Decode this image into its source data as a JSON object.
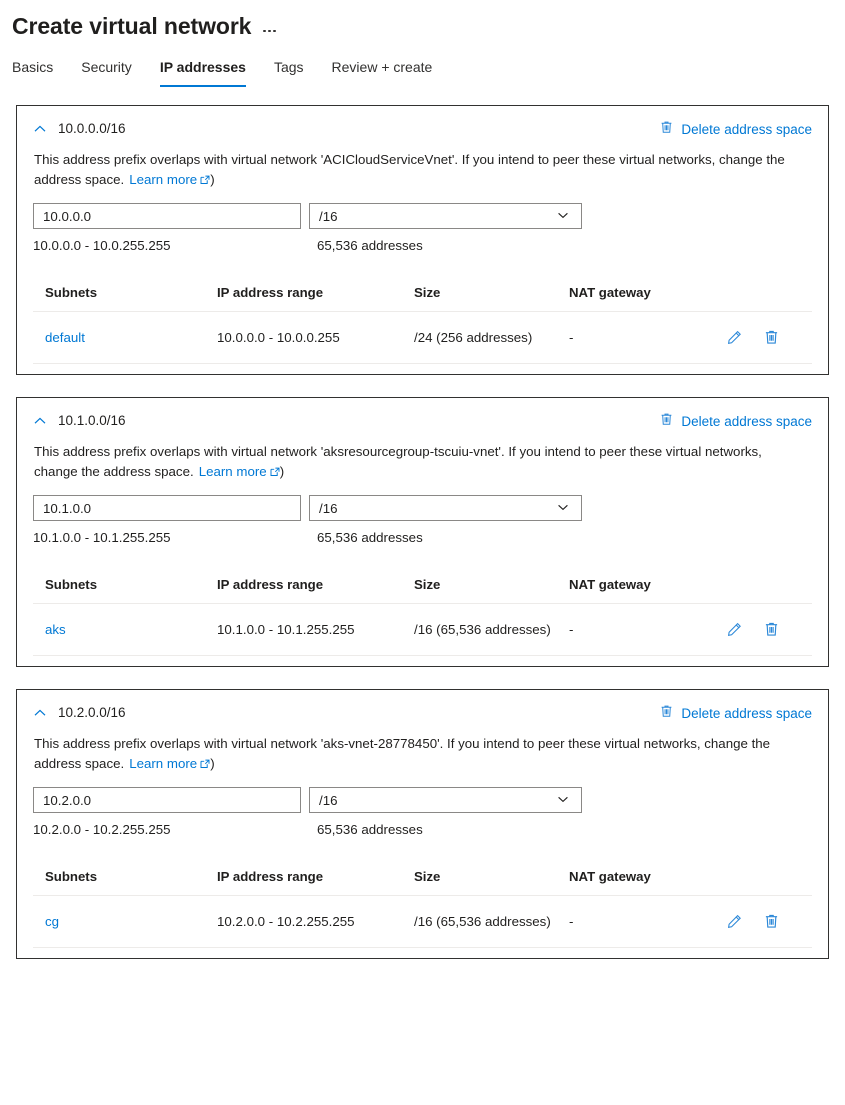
{
  "header": {
    "title": "Create virtual network",
    "more_menu": "…"
  },
  "tabs": [
    {
      "label": "Basics",
      "active": false
    },
    {
      "label": "Security",
      "active": false
    },
    {
      "label": "IP addresses",
      "active": true
    },
    {
      "label": "Tags",
      "active": false
    },
    {
      "label": "Review + create",
      "active": false
    }
  ],
  "labels": {
    "delete_address_space": "Delete address space",
    "learn_more": "Learn more",
    "learn_more_suffix": ")",
    "col_subnets": "Subnets",
    "col_ip_range": "IP address range",
    "col_size": "Size",
    "col_nat": "NAT gateway"
  },
  "colors": {
    "accent": "#0078d4",
    "link": "#0078d4",
    "text": "#201f1e",
    "border": "#323130",
    "field_border": "#8a8886",
    "divider": "#edebe9"
  },
  "address_spaces": [
    {
      "prefix": "10.0.0.0/16",
      "message_before": "This address prefix overlaps with virtual network 'ACICloudServiceVnet'. If you intend to peer these virtual networks, change the address space.",
      "address_value": "10.0.0.0",
      "cidr_value": "/16",
      "range_text": "10.0.0.0 - 10.0.255.255",
      "addresses_text": "65,536 addresses",
      "subnets": [
        {
          "name": "default",
          "ip_range": "10.0.0.0 - 10.0.0.255",
          "size": "/24 (256 addresses)",
          "nat_gateway": "-"
        }
      ]
    },
    {
      "prefix": "10.1.0.0/16",
      "message_before": "This address prefix overlaps with virtual network 'aksresourcegroup-tscuiu-vnet'. If you intend to peer these virtual networks, change the address space.",
      "address_value": "10.1.0.0",
      "cidr_value": "/16",
      "range_text": "10.1.0.0 - 10.1.255.255",
      "addresses_text": "65,536 addresses",
      "subnets": [
        {
          "name": "aks",
          "ip_range": "10.1.0.0 - 10.1.255.255",
          "size": "/16 (65,536 addresses)",
          "nat_gateway": "-"
        }
      ]
    },
    {
      "prefix": "10.2.0.0/16",
      "message_before": "This address prefix overlaps with virtual network 'aks-vnet-28778450'. If you intend to peer these virtual networks, change the address space.",
      "address_value": "10.2.0.0",
      "cidr_value": "/16",
      "range_text": "10.2.0.0 - 10.2.255.255",
      "addresses_text": "65,536 addresses",
      "subnets": [
        {
          "name": "cg",
          "ip_range": "10.2.0.0 - 10.2.255.255",
          "size": "/16 (65,536 addresses)",
          "nat_gateway": "-"
        }
      ]
    }
  ]
}
